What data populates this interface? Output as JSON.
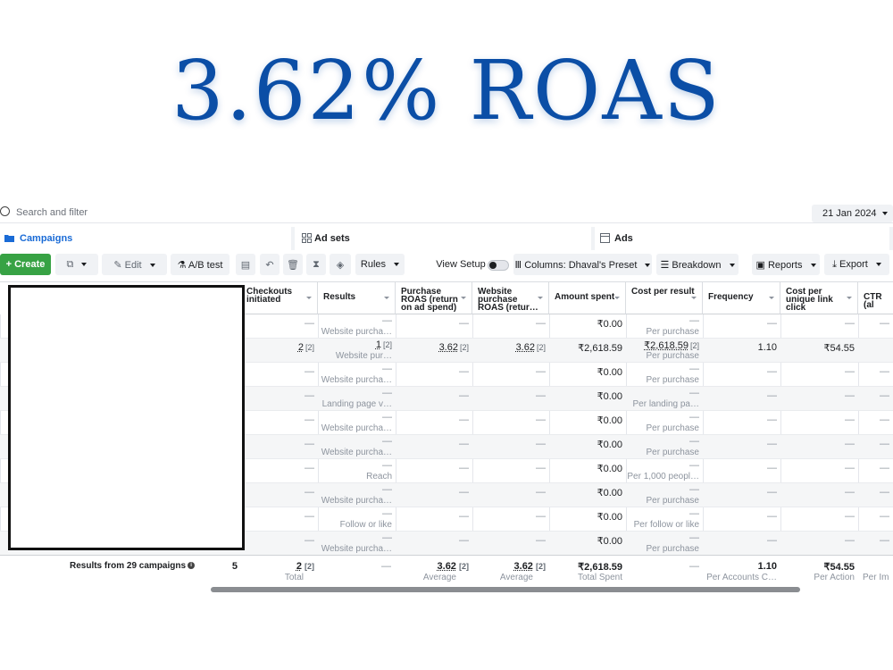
{
  "headline": "3.62% ROAS",
  "search": {
    "placeholder": "Search and filter",
    "date": "21 Jan 2024"
  },
  "tabs": {
    "campaigns": "Campaigns",
    "adsets": "Ad sets",
    "ads": "Ads"
  },
  "toolbar": {
    "create": "Create",
    "edit": "Edit",
    "ab_test": "A/B test",
    "rules": "Rules",
    "view_setup": "View Setup",
    "columns": "Columns: Dhaval's Preset",
    "breakdown": "Breakdown",
    "reports": "Reports",
    "export": "Export"
  },
  "columns": {
    "checkouts": "Checkouts initiated",
    "results": "Results",
    "purchase_roas": "Purchase ROAS (return on ad spend)",
    "website_roas": "Website purchase ROAS (retur…",
    "amount_spent": "Amount spent",
    "cost_per_result": "Cost per result",
    "frequency": "Frequency",
    "cost_per_link": "Cost per unique link click",
    "ctr": "CTR (al"
  },
  "rows": [
    {
      "checkouts": "—",
      "result": "—",
      "result_sub": "Website purcha…",
      "p_roas": "—",
      "w_roas": "—",
      "spent": "₹0.00",
      "cpr": "—",
      "cpr_sub": "Per purchase",
      "freq": "—",
      "cpl": "—",
      "ctr": "—"
    },
    {
      "checkouts": "2",
      "checkouts_br": "[2]",
      "result": "1",
      "result_br": "[2]",
      "result_sub": "Website pur…",
      "p_roas": "3.62",
      "p_roas_br": "[2]",
      "w_roas": "3.62",
      "w_roas_br": "[2]",
      "spent": "₹2,618.59",
      "cpr": "₹2,618.59",
      "cpr_br": "[2]",
      "cpr_sub": "Per purchase",
      "freq": "1.10",
      "cpl": "₹54.55",
      "ctr": ""
    },
    {
      "checkouts": "—",
      "result": "—",
      "result_sub": "Website purcha…",
      "p_roas": "—",
      "w_roas": "—",
      "spent": "₹0.00",
      "cpr": "—",
      "cpr_sub": "Per purchase",
      "freq": "—",
      "cpl": "—",
      "ctr": "—"
    },
    {
      "checkouts": "—",
      "result": "—",
      "result_sub": "Landing page v…",
      "p_roas": "—",
      "w_roas": "—",
      "spent": "₹0.00",
      "cpr": "—",
      "cpr_sub": "Per landing pa…",
      "freq": "—",
      "cpl": "—",
      "ctr": "—"
    },
    {
      "checkouts": "—",
      "result": "—",
      "result_sub": "Website purcha…",
      "p_roas": "—",
      "w_roas": "—",
      "spent": "₹0.00",
      "cpr": "—",
      "cpr_sub": "Per purchase",
      "freq": "—",
      "cpl": "—",
      "ctr": "—"
    },
    {
      "checkouts": "—",
      "result": "—",
      "result_sub": "Website purcha…",
      "p_roas": "—",
      "w_roas": "—",
      "spent": "₹0.00",
      "cpr": "—",
      "cpr_sub": "Per purchase",
      "freq": "—",
      "cpl": "—",
      "ctr": "—"
    },
    {
      "checkouts": "—",
      "result": "—",
      "result_sub": "Reach",
      "p_roas": "—",
      "w_roas": "—",
      "spent": "₹0.00",
      "cpr": "—",
      "cpr_sub": "Per 1,000 peopl…",
      "freq": "—",
      "cpl": "—",
      "ctr": "—"
    },
    {
      "checkouts": "—",
      "result": "—",
      "result_sub": "Website purcha…",
      "p_roas": "—",
      "w_roas": "—",
      "spent": "₹0.00",
      "cpr": "—",
      "cpr_sub": "Per purchase",
      "freq": "—",
      "cpl": "—",
      "ctr": "—"
    },
    {
      "checkouts": "—",
      "result": "—",
      "result_sub": "Follow or like",
      "p_roas": "—",
      "w_roas": "—",
      "spent": "₹0.00",
      "cpr": "—",
      "cpr_sub": "Per follow or like",
      "freq": "—",
      "cpl": "—",
      "ctr": "—"
    },
    {
      "checkouts": "—",
      "result": "—",
      "result_sub": "Website purcha…",
      "p_roas": "—",
      "w_roas": "—",
      "spent": "₹0.00",
      "cpr": "—",
      "cpr_sub": "Per purchase",
      "freq": "—",
      "cpl": "—",
      "ctr": "—"
    }
  ],
  "totals": {
    "label": "Results from 29 campaigns",
    "prev_col": "5",
    "checkouts": "2",
    "checkouts_br": "[2]",
    "checkouts_sub": "Total",
    "result": "—",
    "p_roas": "3.62",
    "p_roas_br": "[2]",
    "p_roas_sub": "Average",
    "w_roas": "3.62",
    "w_roas_br": "[2]",
    "w_roas_sub": "Average",
    "spent": "₹2,618.59",
    "spent_sub": "Total Spent",
    "cpr": "—",
    "freq": "1.10",
    "freq_sub": "Per Accounts C…",
    "cpl": "₹54.55",
    "cpl_sub": "Per Action",
    "ctr_sub": "Per Im"
  }
}
